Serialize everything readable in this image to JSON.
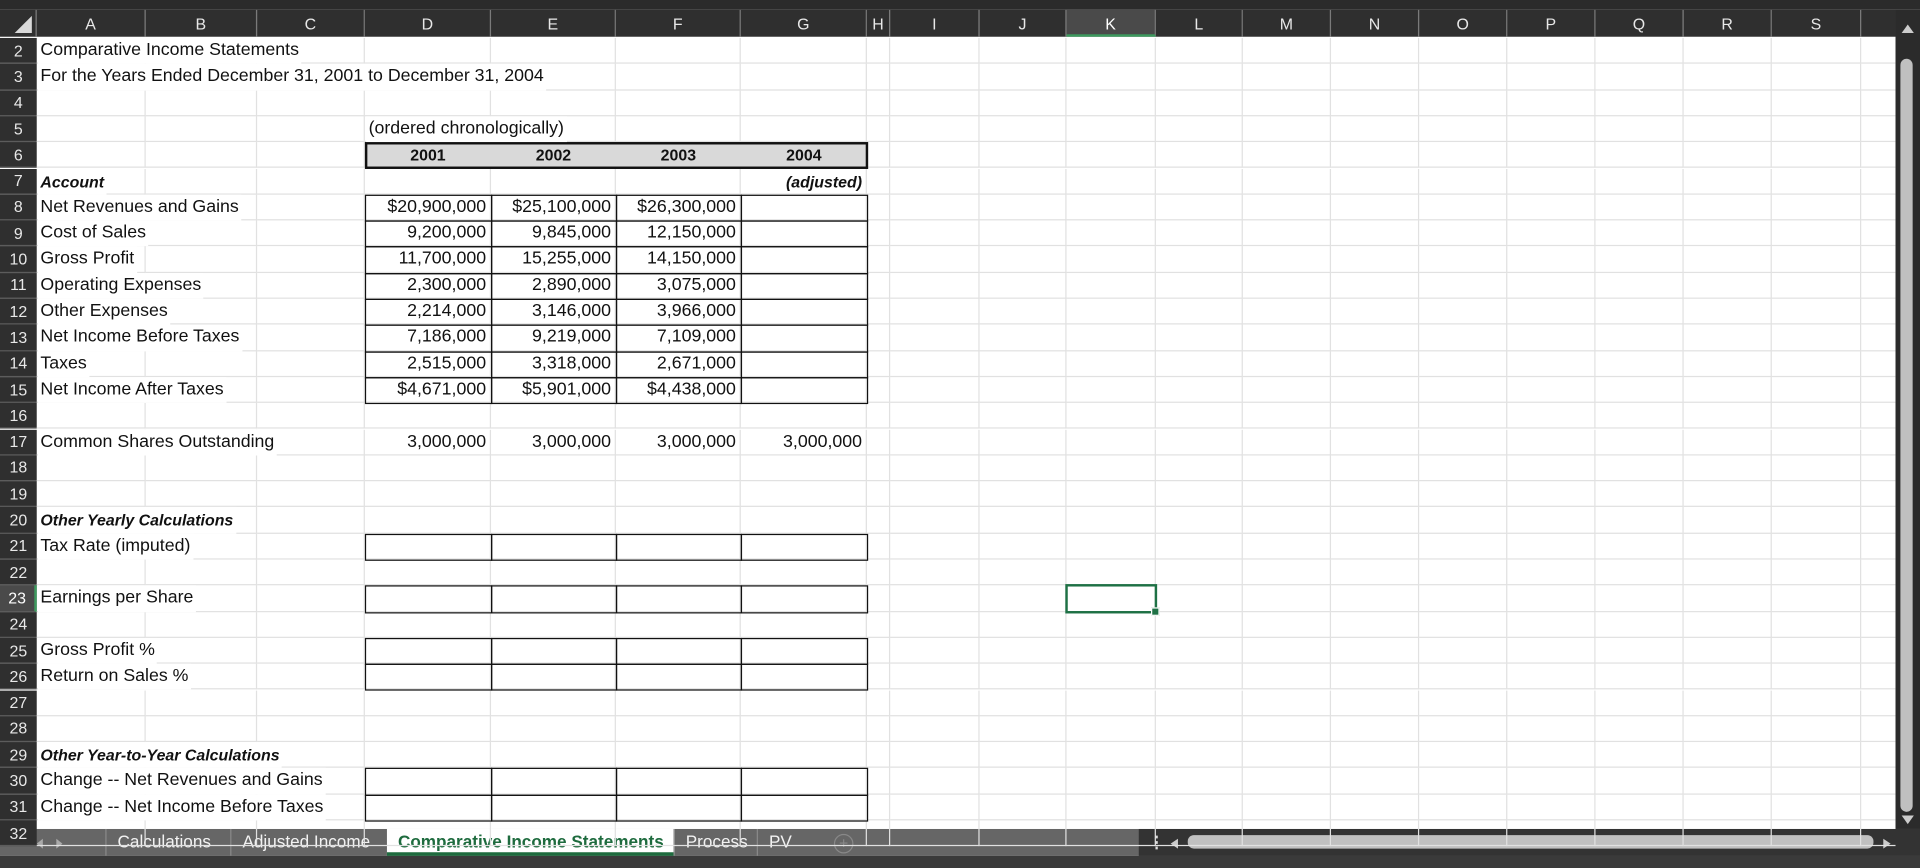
{
  "columns": [
    "A",
    "B",
    "C",
    "D",
    "E",
    "F",
    "G",
    "H",
    "I",
    "J",
    "K",
    "L",
    "M",
    "N",
    "O",
    "P",
    "Q",
    "R",
    "S"
  ],
  "row_numbers": [
    2,
    3,
    4,
    5,
    6,
    7,
    8,
    9,
    10,
    11,
    12,
    13,
    14,
    15,
    16,
    17,
    18,
    19,
    20,
    21,
    22,
    23,
    24,
    25,
    26,
    27,
    28,
    29,
    30,
    31,
    32
  ],
  "selected_cell": "K23",
  "cells": {
    "A2": "Comparative Income Statements",
    "A3": "For the Years Ended December 31, 2001 to December 31, 2004",
    "D5": "(ordered chronologically)",
    "D6": "2001",
    "E6": "2002",
    "F6": "2003",
    "G6": "2004",
    "A7": "Account",
    "G7": "(adjusted)",
    "A8": "Net Revenues and Gains",
    "D8": "$20,900,000",
    "E8": "$25,100,000",
    "F8": "$26,300,000",
    "A9": "Cost of Sales",
    "D9": "9,200,000",
    "E9": "9,845,000",
    "F9": "12,150,000",
    "A10": "Gross Profit",
    "D10": "11,700,000",
    "E10": "15,255,000",
    "F10": "14,150,000",
    "A11": "Operating Expenses",
    "D11": "2,300,000",
    "E11": "2,890,000",
    "F11": "3,075,000",
    "A12": "Other Expenses",
    "D12": "2,214,000",
    "E12": "3,146,000",
    "F12": "3,966,000",
    "A13": "Net Income Before Taxes",
    "D13": "7,186,000",
    "E13": "9,219,000",
    "F13": "7,109,000",
    "A14": "Taxes",
    "D14": "2,515,000",
    "E14": "3,318,000",
    "F14": "2,671,000",
    "A15": "Net Income After Taxes",
    "D15": "$4,671,000",
    "E15": "$5,901,000",
    "F15": "$4,438,000",
    "A17": "Common Shares Outstanding",
    "D17": "3,000,000",
    "E17": "3,000,000",
    "F17": "3,000,000",
    "G17": "3,000,000",
    "A20": "Other Yearly Calculations",
    "A21": "Tax Rate (imputed)",
    "A23": "Earnings per Share",
    "A25": "Gross Profit %",
    "A26": "Return on Sales %",
    "A29": "Other Year-to-Year Calculations",
    "A30": "Change -- Net Revenues and Gains",
    "A31": "Change -- Net Income Before Taxes"
  },
  "sheet_tabs": [
    {
      "label": "Calculations",
      "active": false
    },
    {
      "label": "Adjusted Income",
      "active": false
    },
    {
      "label": "Comparative Income Statements",
      "active": true
    },
    {
      "label": "Process",
      "active": false
    },
    {
      "label": "PV",
      "active": false
    }
  ],
  "add_sheet_icon": "+",
  "colors": {
    "accent": "#1e6b3e",
    "header_bg": "#2f2f2f",
    "gridline": "#e1e1e1",
    "table_header_fill": "#d9d9d9"
  }
}
